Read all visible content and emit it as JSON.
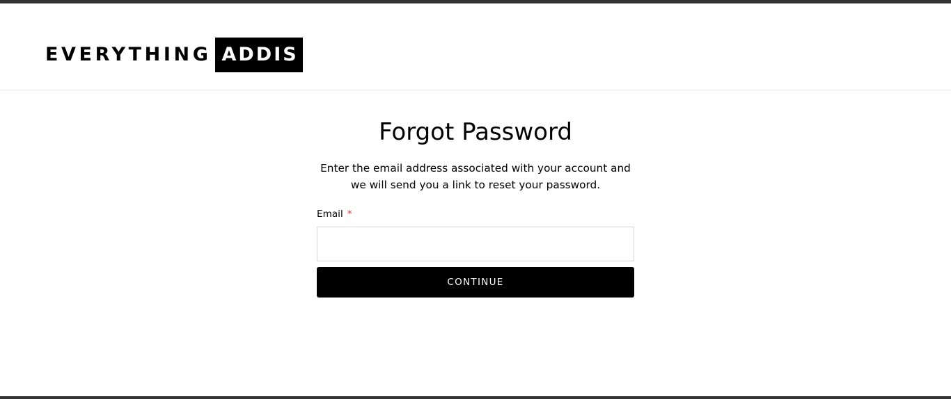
{
  "header": {
    "logo": {
      "word1": "EVERYTHING",
      "word2": "ADDIS"
    }
  },
  "form": {
    "title": "Forgot Password",
    "description": "Enter the email address associated with your account and we will send you a link to reset your password.",
    "email_label": "Email",
    "required_marker": "*",
    "email_value": "",
    "email_placeholder": "",
    "submit_label": "CONTINUE"
  },
  "colors": {
    "accent": "#000000",
    "required": "#e0322e",
    "frame_bar": "#333333"
  }
}
